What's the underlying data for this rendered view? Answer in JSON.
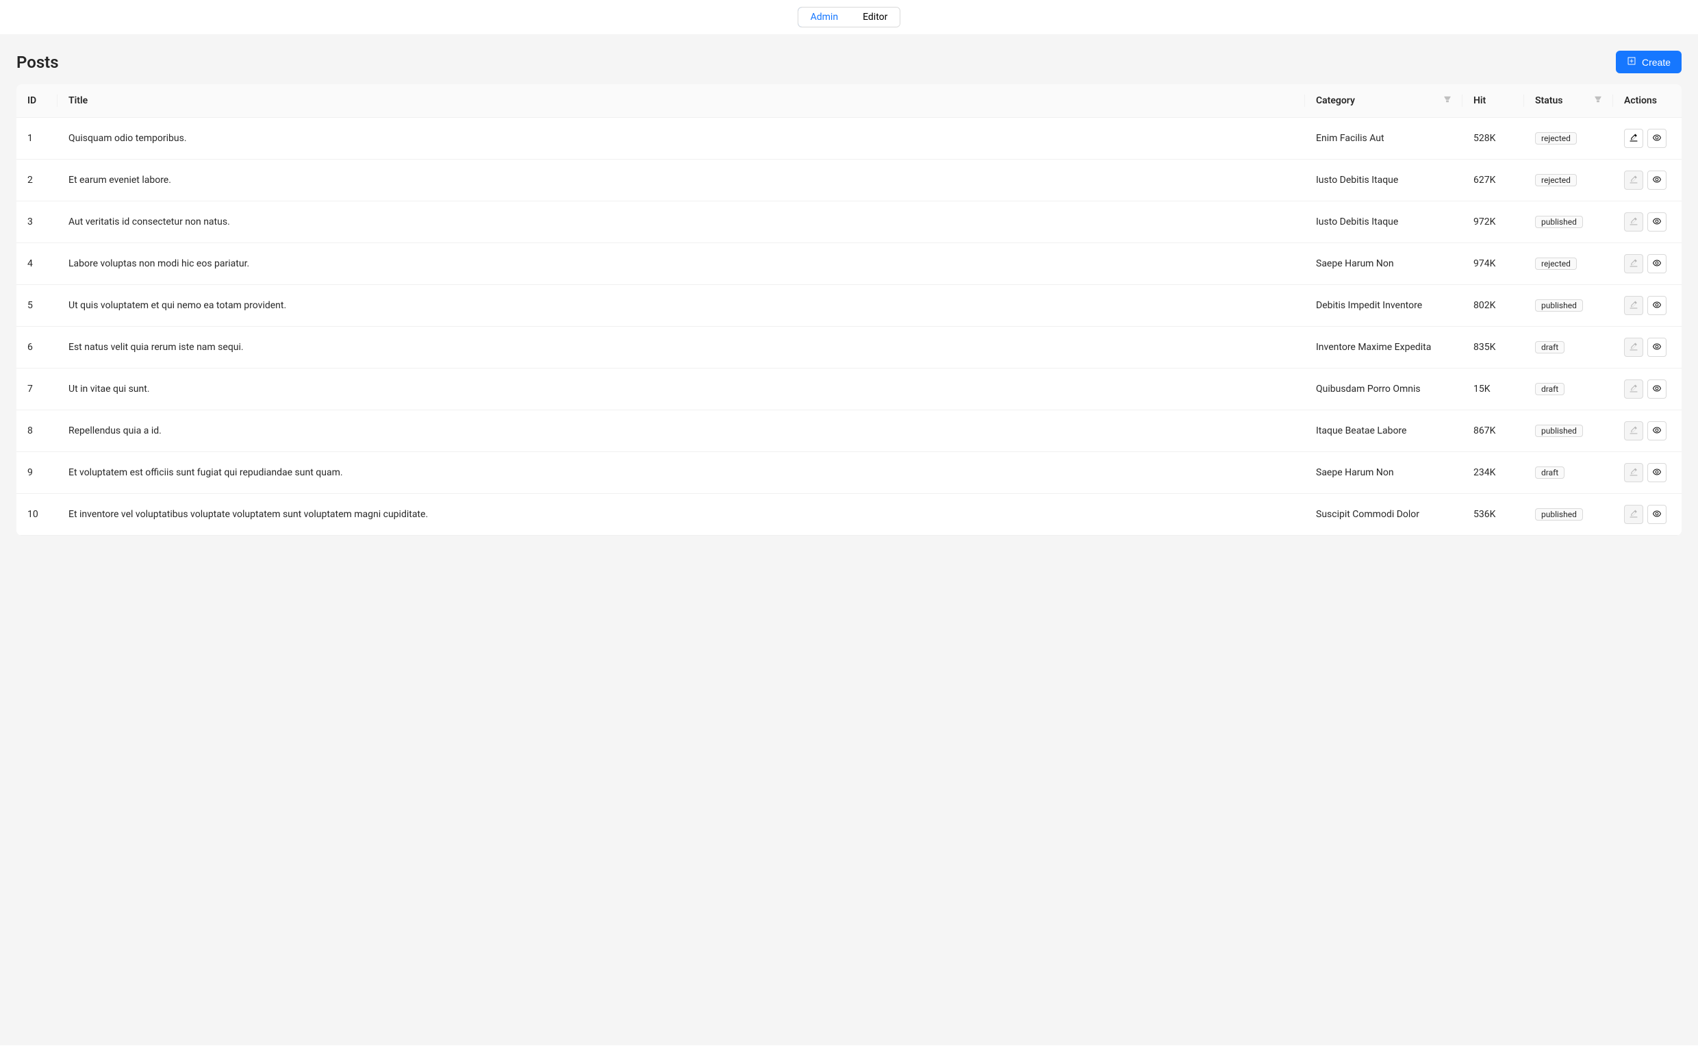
{
  "nav": {
    "tabs": [
      {
        "label": "Admin",
        "active": true
      },
      {
        "label": "Editor",
        "active": false
      }
    ]
  },
  "header": {
    "title": "Posts",
    "createLabel": "Create"
  },
  "table": {
    "columns": {
      "id": "ID",
      "title": "Title",
      "category": "Category",
      "hit": "Hit",
      "status": "Status",
      "actions": "Actions"
    },
    "rows": [
      {
        "id": "1",
        "title": "Quisquam odio temporibus.",
        "category": "Enim Facilis Aut",
        "hit": "528K",
        "status": "rejected",
        "editEnabled": true
      },
      {
        "id": "2",
        "title": "Et earum eveniet labore.",
        "category": "Iusto Debitis Itaque",
        "hit": "627K",
        "status": "rejected",
        "editEnabled": false
      },
      {
        "id": "3",
        "title": "Aut veritatis id consectetur non natus.",
        "category": "Iusto Debitis Itaque",
        "hit": "972K",
        "status": "published",
        "editEnabled": false
      },
      {
        "id": "4",
        "title": "Labore voluptas non modi hic eos pariatur.",
        "category": "Saepe Harum Non",
        "hit": "974K",
        "status": "rejected",
        "editEnabled": false
      },
      {
        "id": "5",
        "title": "Ut quis voluptatem et qui nemo ea totam provident.",
        "category": "Debitis Impedit Inventore",
        "hit": "802K",
        "status": "published",
        "editEnabled": false
      },
      {
        "id": "6",
        "title": "Est natus velit quia rerum iste nam sequi.",
        "category": "Inventore Maxime Expedita",
        "hit": "835K",
        "status": "draft",
        "editEnabled": false
      },
      {
        "id": "7",
        "title": "Ut in vitae qui sunt.",
        "category": "Quibusdam Porro Omnis",
        "hit": "15K",
        "status": "draft",
        "editEnabled": false
      },
      {
        "id": "8",
        "title": "Repellendus quia a id.",
        "category": "Itaque Beatae Labore",
        "hit": "867K",
        "status": "published",
        "editEnabled": false
      },
      {
        "id": "9",
        "title": "Et voluptatem est officiis sunt fugiat qui repudiandae sunt quam.",
        "category": "Saepe Harum Non",
        "hit": "234K",
        "status": "draft",
        "editEnabled": false
      },
      {
        "id": "10",
        "title": "Et inventore vel voluptatibus voluptate voluptatem sunt voluptatem magni cupiditate.",
        "category": "Suscipit Commodi Dolor",
        "hit": "536K",
        "status": "published",
        "editEnabled": false
      }
    ]
  }
}
